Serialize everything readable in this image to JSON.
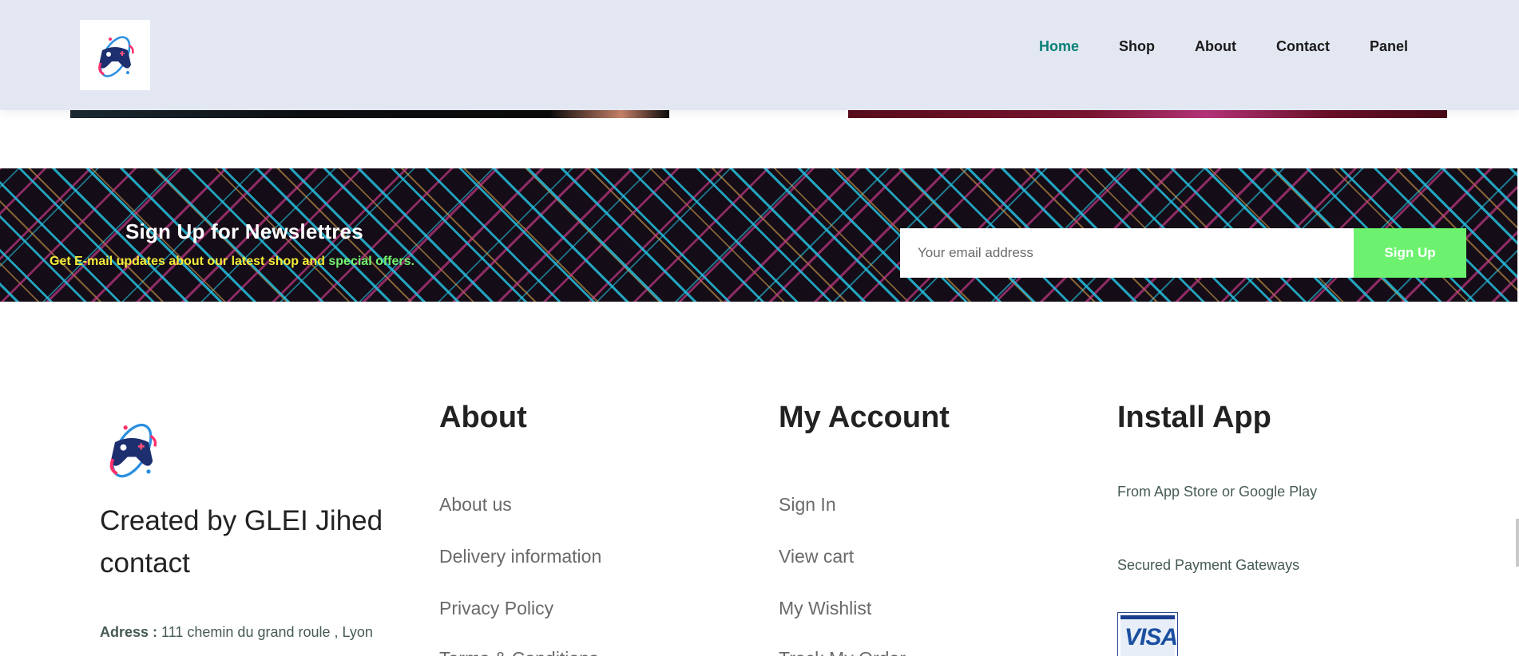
{
  "nav": {
    "items": [
      {
        "label": "Home",
        "active": true
      },
      {
        "label": "Shop",
        "active": false
      },
      {
        "label": "About",
        "active": false
      },
      {
        "label": "Contact",
        "active": false
      },
      {
        "label": "Panel",
        "active": false
      }
    ]
  },
  "newsletter": {
    "title": "Sign Up for Newslettres",
    "subtitle_before": "Get E-mail updates about our latest shop and ",
    "subtitle_highlight": "special offers.",
    "placeholder": "Your email address",
    "button_label": "Sign Up"
  },
  "footer": {
    "created_line1": "Created by GLEI Jihed",
    "created_line2": "contact",
    "address_label": "Adress :",
    "address_value": "111 chemin du grand roule , Lyon",
    "about": {
      "title": "About",
      "links": [
        "About us",
        "Delivery information",
        "Privacy Policy",
        "Terms & Conditions"
      ]
    },
    "account": {
      "title": "My Account",
      "links": [
        "Sign In",
        "View cart",
        "My Wishlist",
        "Track My Order"
      ]
    },
    "install": {
      "title": "Install App",
      "store_text": "From App Store or Google Play",
      "payment_text": "Secured Payment Gateways",
      "visa_label": "VISA"
    }
  },
  "colors": {
    "header_bg": "#e3e7f2",
    "nav_active": "#088178",
    "signup_button": "#6cf26f",
    "newsletter_subtitle": "#f4ec38",
    "newsletter_highlight": "#73f26e"
  },
  "icons": {
    "logo": "gamepad-planet-logo-icon"
  }
}
